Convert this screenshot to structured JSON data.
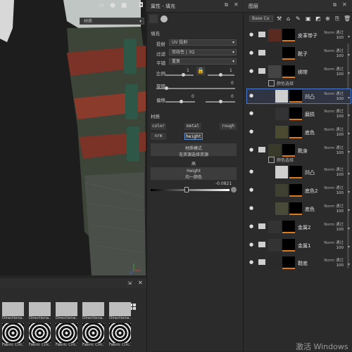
{
  "viewport": {
    "toolbar_icons": [
      "frame-icon",
      "sphere-icon",
      "camera-icon",
      "screenshot-icon"
    ],
    "dropdown_value": "材质"
  },
  "properties": {
    "title": "属性 - 填充",
    "section_fill": "填充",
    "projection_label": "投射",
    "projection_value": "UV 投射",
    "filter_label": "过滤",
    "filter_value": "双线性 | 3Q",
    "tile_label": "平铺",
    "tile_value": "重复",
    "scale_label": "比例",
    "scale_value": "1",
    "rotate_label": "旋转",
    "rotate_value": "0",
    "offset_label": "偏移",
    "offset_x": "0",
    "offset_y": "0",
    "section_material": "材质",
    "channels": [
      "color",
      "metal",
      "rough",
      "nrm",
      "height"
    ],
    "material_mode_label": "材质模式",
    "material_mode_value": "无资源选择资源",
    "height_section": "高",
    "height_label": "Height",
    "height_sub": "均一颜色",
    "height_value": "-0.0821"
  },
  "layers": {
    "title": "图层",
    "blend_dropdown": "Base Co",
    "items": [
      {
        "name": "皮革带子",
        "blend": "Norm 通过",
        "opacity": "100",
        "type": "folder"
      },
      {
        "name": "靴子",
        "blend": "Norm 通过",
        "opacity": "100",
        "type": "folder"
      },
      {
        "name": "绑带",
        "blend": "Norm 通过",
        "opacity": "100",
        "type": "folder"
      },
      {
        "name": "凹凸",
        "blend": "Norm 通过",
        "opacity": "100",
        "type": "layer",
        "selected": true
      },
      {
        "name": "磨损",
        "blend": "Norm 通过",
        "opacity": "100",
        "type": "layer"
      },
      {
        "name": "底色",
        "blend": "Norm 通过",
        "opacity": "100",
        "type": "layer"
      },
      {
        "name": "靴身",
        "blend": "Norm 通过",
        "opacity": "100",
        "type": "folder"
      },
      {
        "name": "凹凸",
        "blend": "Norm 通过",
        "opacity": "100",
        "type": "layer"
      },
      {
        "name": "底色2",
        "blend": "Norm 通过",
        "opacity": "100",
        "type": "layer"
      },
      {
        "name": "底色",
        "blend": "Norm 通过",
        "opacity": "100",
        "type": "layer"
      },
      {
        "name": "金属2",
        "blend": "Norm 通过",
        "opacity": "100",
        "type": "folder"
      },
      {
        "name": "金属1",
        "blend": "Norm 通过",
        "opacity": "100",
        "type": "folder"
      },
      {
        "name": "鞋底",
        "blend": "Norm 通过",
        "opacity": "100",
        "type": "folder"
      }
    ],
    "subrows": [
      "颜色选择",
      "颜色选择"
    ]
  },
  "shelf": {
    "row1_labels": [
      "Directiona...",
      "Directiona...",
      "Directiona...",
      "Directiona...",
      "Directiona..."
    ],
    "row2_labels": [
      "Fabric Circ...",
      "Fabric Circ...",
      "Fabric Circ...",
      "Fabric Circ...",
      "Fabric Circ..."
    ]
  },
  "watermark": "激活 Windows"
}
